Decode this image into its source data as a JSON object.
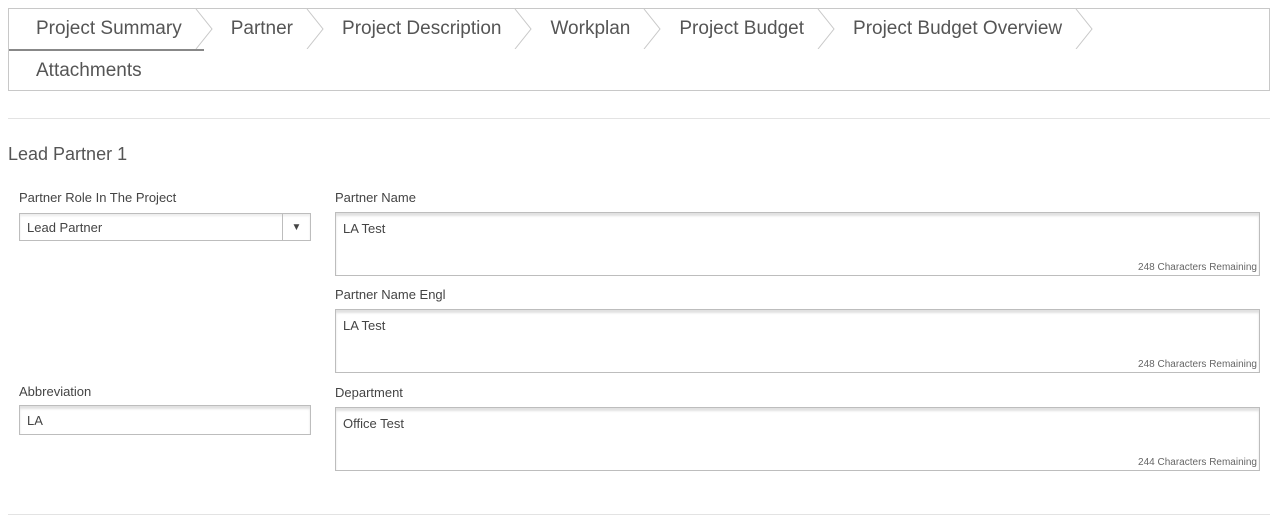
{
  "tabs": {
    "row1": [
      "Project Summary",
      "Partner",
      "Project Description",
      "Workplan",
      "Project Budget",
      "Project Budget Overview"
    ],
    "row2": [
      "Attachments"
    ]
  },
  "section": {
    "title": "Lead Partner 1"
  },
  "form": {
    "role_label": "Partner Role In The Project",
    "role_value": "Lead Partner",
    "abbr_label": "Abbreviation",
    "abbr_value": "LA",
    "partner_name_label": "Partner Name",
    "partner_name_value": "LA Test",
    "partner_name_remaining": "248 Characters Remaining",
    "partner_name_engl_label": "Partner Name Engl",
    "partner_name_engl_value": "LA Test",
    "partner_name_engl_remaining": "248 Characters Remaining",
    "department_label": "Department",
    "department_value": "Office Test",
    "department_remaining": "244 Characters Remaining"
  },
  "icons": {
    "dropdown": "chevron-down-icon",
    "tab_separator": "chevron-right-icon"
  }
}
